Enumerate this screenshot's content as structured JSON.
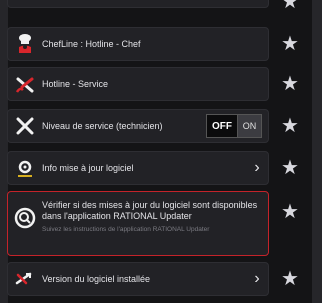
{
  "top_row": {
    "faded_text": ""
  },
  "rows": [
    {
      "label": "ChefLine : Hotline - Chef"
    },
    {
      "label": "Hotline - Service"
    },
    {
      "label": "Niveau de service (technicien)",
      "toggle_off": "OFF",
      "toggle_on": "ON"
    },
    {
      "label": "Info mise à jour logiciel"
    },
    {
      "label": "Vérifier si des mises à jour du logiciel sont disponibles dans l'application RATIONAL Updater",
      "sub": "Suivez les instructions de l'application RATIONAL Updater"
    },
    {
      "label": "Version du logiciel installée"
    }
  ],
  "icons": {
    "chef": "chef-icon",
    "hotline": "hotline-icon",
    "service": "tools-icon",
    "info": "gear-info-icon",
    "search": "search-update-icon",
    "version": "version-icon",
    "star": "star-icon"
  },
  "colors": {
    "accent_red": "#c4232a",
    "background": "#141416",
    "row_bg": "#222226"
  }
}
